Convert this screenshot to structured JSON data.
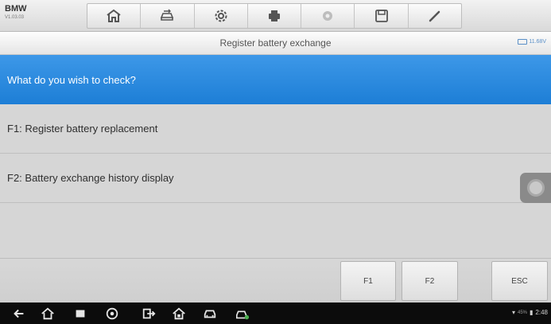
{
  "header": {
    "brand": "BMW",
    "version": "V1.03.03",
    "toolbar_icons": [
      "home-icon",
      "vehicle-swap-icon",
      "gear-icon",
      "printer-icon",
      "help-icon",
      "save-icon",
      "pencil-icon"
    ]
  },
  "title": {
    "text": "Register battery exchange",
    "voltage": "11.68V"
  },
  "question": "What do you wish to check?",
  "options": [
    {
      "label": "F1: Register battery replacement"
    },
    {
      "label": "F2: Battery exchange history display"
    }
  ],
  "function_keys": {
    "f1": "F1",
    "f2": "F2",
    "esc": "ESC"
  },
  "navbar": {
    "icons": [
      "back-icon",
      "home-icon",
      "recent-apps-icon",
      "chrome-icon",
      "exit-icon",
      "maxisys-home-icon",
      "car-icon",
      "vci-icon"
    ],
    "battery_percent": "45%",
    "time": "2:48"
  },
  "colors": {
    "accent": "#1d7ed6",
    "background": "#d6d6d6"
  }
}
